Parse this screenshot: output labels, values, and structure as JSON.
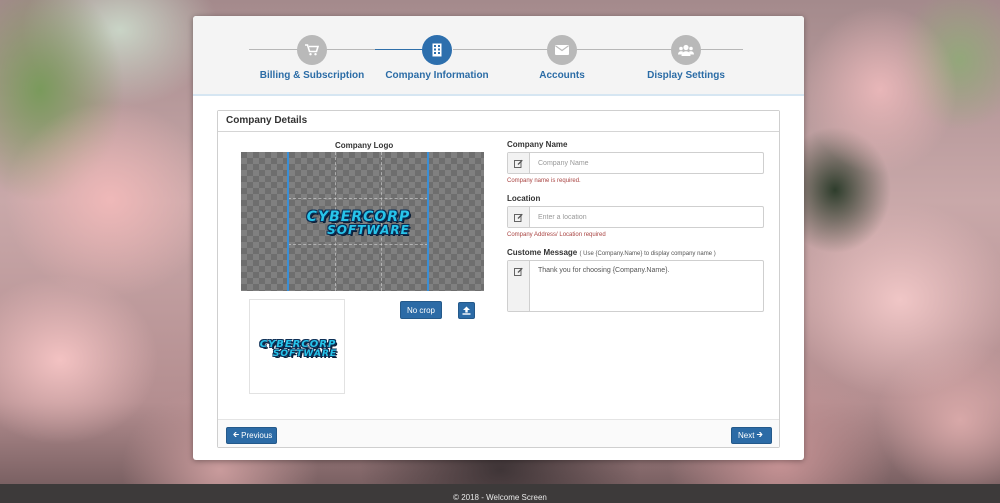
{
  "wizard": {
    "steps": [
      {
        "label": "Billing & Subscription",
        "icon": "cart-icon",
        "active": false
      },
      {
        "label": "Company Information",
        "icon": "building-icon",
        "active": true
      },
      {
        "label": "Accounts",
        "icon": "envelope-icon",
        "active": false
      },
      {
        "label": "Display Settings",
        "icon": "users-icon",
        "active": false
      }
    ]
  },
  "panel": {
    "title": "Company Details",
    "logo": {
      "label": "Company Logo",
      "logo_line1": "CYBERCORP",
      "logo_line2": "SOFTWARE",
      "no_crop_label": "No crop"
    },
    "fields": {
      "company_name": {
        "label": "Company Name",
        "placeholder": "Company Name",
        "error": "Company name is required."
      },
      "location": {
        "label": "Location",
        "placeholder": "Enter a location",
        "error": "Company Address/ Location required"
      },
      "message": {
        "label": "Custome Message",
        "hint": "( Use {Company.Name} to display company name )",
        "value": "Thank you for choosing {Company.Name}."
      }
    },
    "footer": {
      "previous_label": "Previous",
      "next_label": "Next"
    }
  },
  "page_footer": "© 2018 - Welcome Screen",
  "colors": {
    "primary": "#2c6ba6",
    "step_inactive": "#b9b9b9",
    "error": "#a94442",
    "logo_cyan": "#27c4ea"
  }
}
